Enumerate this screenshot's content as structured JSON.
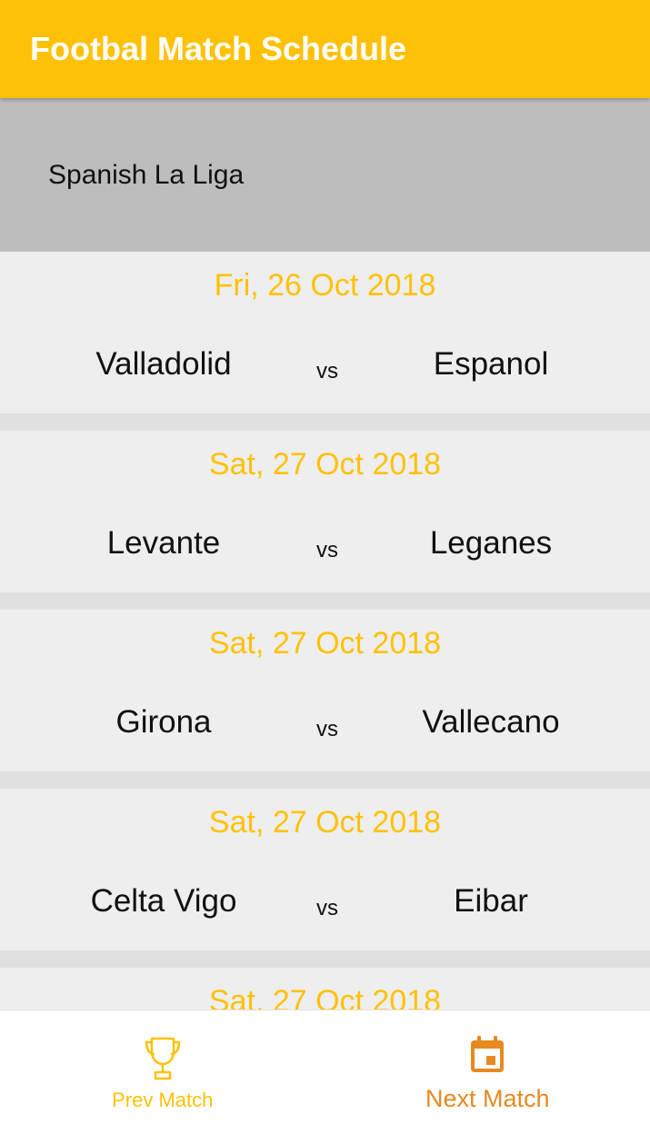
{
  "appbar": {
    "title": "Footbal Match Schedule"
  },
  "league": {
    "selected": "Spanish La Liga"
  },
  "matches": [
    {
      "date": "Fri, 26 Oct 2018",
      "home": "Valladolid",
      "vs": "vs",
      "away": "Espanol"
    },
    {
      "date": "Sat, 27 Oct 2018",
      "home": "Levante",
      "vs": "vs",
      "away": "Leganes"
    },
    {
      "date": "Sat, 27 Oct 2018",
      "home": "Girona",
      "vs": "vs",
      "away": "Vallecano"
    },
    {
      "date": "Sat, 27 Oct 2018",
      "home": "Celta Vigo",
      "vs": "vs",
      "away": "Eibar"
    },
    {
      "date": "Sat, 27 Oct 2018"
    }
  ],
  "bottom_nav": {
    "items": [
      {
        "label": "Prev Match",
        "icon": "trophy-icon",
        "active": false
      },
      {
        "label": "Next Match",
        "icon": "calendar-icon",
        "active": true
      }
    ]
  },
  "colors": {
    "primary": "#ffc107",
    "active_nav": "#e8891f",
    "league_bar": "#bdbdbd",
    "card": "#eeeeee",
    "divider": "#e0e0e0"
  }
}
